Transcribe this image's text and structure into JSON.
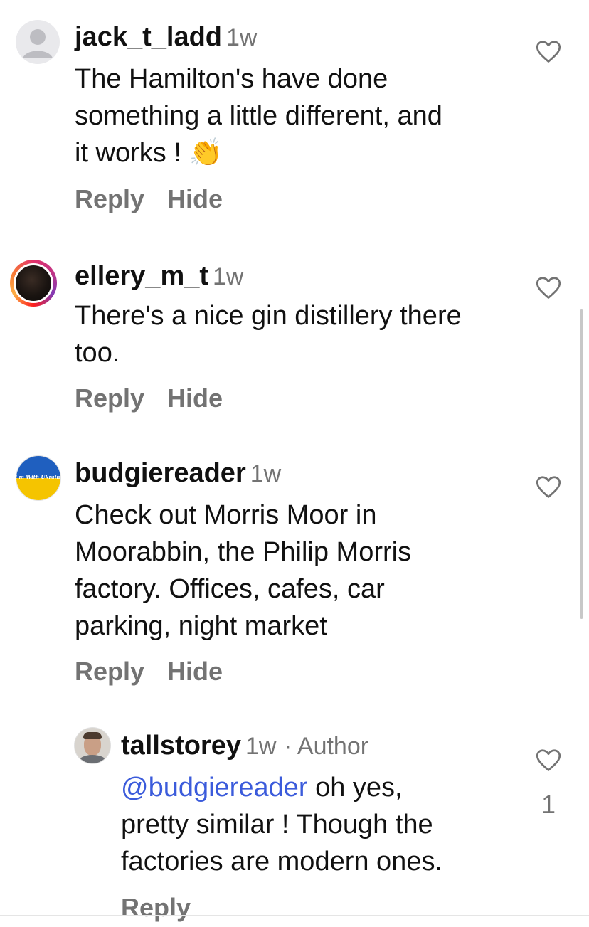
{
  "comments": [
    {
      "username": "jack_t_ladd",
      "time": "1w",
      "lines": [
        "The Hamilton's have done",
        "something a little different, and",
        "it works ! 👏"
      ],
      "reply_label": "Reply",
      "hide_label": "Hide"
    },
    {
      "username": "ellery_m_t",
      "time": "1w",
      "lines": [
        "There's a nice gin distillery there",
        "too."
      ],
      "reply_label": "Reply",
      "hide_label": "Hide"
    },
    {
      "username": "budgiereader",
      "time": "1w",
      "avatar_text": "I'm With Ukraine",
      "lines": [
        "Check out Morris Moor in",
        "Moorabbin, the Philip Morris",
        "factory. Offices, cafes, car",
        "parking, night market"
      ],
      "reply_label": "Reply",
      "hide_label": "Hide"
    },
    {
      "username": "tallstorey",
      "time": "1w",
      "author_label": "· Author",
      "mention": "@budgiereader",
      "line1_rest": " oh yes,",
      "lines": [
        "pretty similar ! Though the",
        "factories are modern ones."
      ],
      "reply_label": "Reply",
      "like_count": "1"
    }
  ],
  "icons": {
    "like": "heart-outline-icon"
  },
  "colors": {
    "mention": "#3b5bdb",
    "secondary_text": "#737373",
    "ukraine_blue": "#1f5fbf",
    "ukraine_yellow": "#f5c400"
  }
}
